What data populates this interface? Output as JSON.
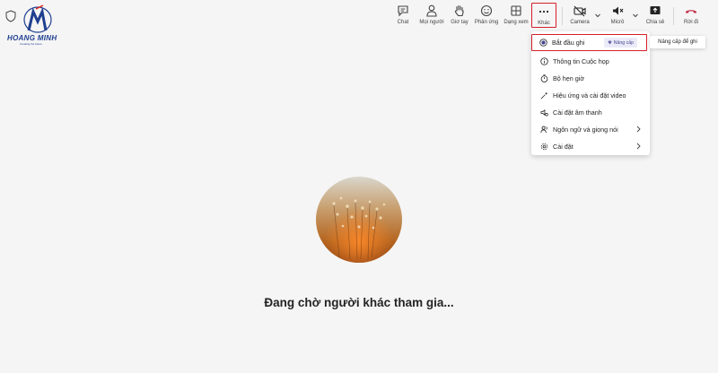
{
  "brand": {
    "name": "HOANG MINH",
    "tagline": "Creating the future"
  },
  "toolbar": {
    "chat": "Chat",
    "people": "Mọi người",
    "raise_hand": "Giơ tay",
    "react": "Phản ứng",
    "view": "Dạng xem",
    "more": "Khác",
    "camera": "Camera",
    "mic": "Micrô",
    "share": "Chia sẻ",
    "leave": "Rời đi"
  },
  "more_menu": {
    "items": [
      {
        "label": "Bắt đầu ghi",
        "icon": "record-icon",
        "badge": "Nâng cấp"
      },
      {
        "label": "Thông tin Cuộc họp",
        "icon": "info-icon"
      },
      {
        "label": "Bộ hẹn giờ",
        "icon": "timer-icon"
      },
      {
        "label": "Hiệu ứng và cài đặt video",
        "icon": "effects-icon"
      },
      {
        "label": "Cài đặt âm thanh",
        "icon": "audio-settings-icon"
      },
      {
        "label": "Ngôn ngữ và giọng nói",
        "icon": "language-icon",
        "submenu": true
      },
      {
        "label": "Cài đặt",
        "icon": "gear-icon",
        "submenu": true
      }
    ]
  },
  "tooltip": "Nâng cấp để ghi",
  "stage": {
    "waiting_text": "Đang chờ người khác tham gia..."
  },
  "colors": {
    "highlight": "#d3202a",
    "leave": "#c4314b",
    "badge_bg": "#ebeaf8",
    "badge_text": "#444791"
  }
}
